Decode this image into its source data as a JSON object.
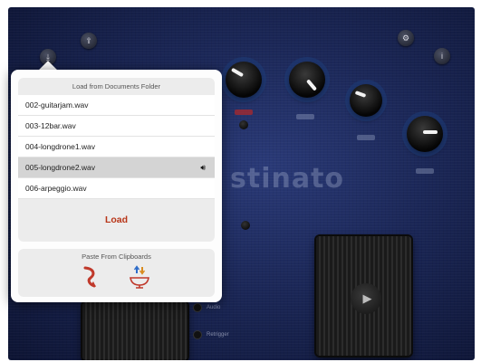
{
  "background_app": {
    "logo_text": "stinato",
    "side_labels": [
      "Audio",
      "Retrigger"
    ],
    "pad_icon": "play-icon"
  },
  "popover": {
    "header": "Load from Documents Folder",
    "files": [
      {
        "name": "002-guitarjam.wav",
        "selected": false
      },
      {
        "name": "003-12bar.wav",
        "selected": false
      },
      {
        "name": "004-longdrone1.wav",
        "selected": false
      },
      {
        "name": "005-longdrone2.wav",
        "selected": true,
        "icon": "speaker-icon"
      },
      {
        "name": "006-arpeggio.wav",
        "selected": false
      }
    ],
    "load_label": "Load",
    "paste_header": "Paste From Clipboards",
    "paste_icons": [
      "paste-arrow-icon",
      "paste-bowl-icon"
    ]
  },
  "colors": {
    "accent": "#b83518",
    "selected_row": "#d4d4d4",
    "app_background": "#1b2757"
  }
}
